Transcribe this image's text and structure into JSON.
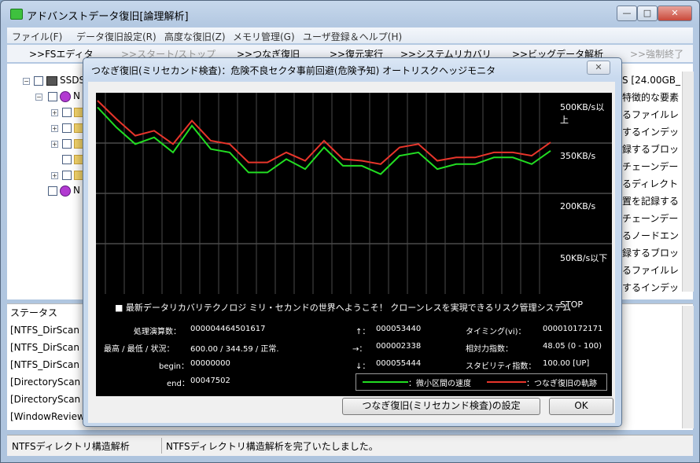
{
  "window": {
    "title": "アドバンストデータ復旧[論理解析]",
    "min_label": "—",
    "max_label": "□",
    "close_label": "✕"
  },
  "menu": [
    "ファイル(F)",
    "データ復旧設定(R)",
    "高度な復旧(Z)",
    "メモリ管理(G)",
    "ユーザ登録＆ヘルプ(H)"
  ],
  "toolbar": [
    {
      "label": ">>FSエディタ",
      "enabled": true
    },
    {
      "label": ">>スタート/ストップ",
      "enabled": false
    },
    {
      "label": ">>つなぎ復旧",
      "enabled": true
    },
    {
      "label": ">>復元実行",
      "enabled": true
    },
    {
      "label": ">>システムリカバリ",
      "enabled": true
    },
    {
      "label": ">>ビッグデータ解析",
      "enabled": true
    },
    {
      "label": ">>強制終了",
      "enabled": false
    }
  ],
  "tree": {
    "root_label": "SSDS",
    "node1_label": "N",
    "node2_label": "N"
  },
  "right_panel": {
    "header": "S [24.00GB_(",
    "rows": [
      "特徴的な要素",
      "るファイルレ",
      "するインデッ",
      "録するブロッ",
      "チェーンデー",
      "るディレクト",
      "置を記録する",
      "チェーンデー",
      "るノードエン",
      "録するブロッ",
      "るファイルレ",
      "するインデッ"
    ]
  },
  "status": {
    "header": "ステータス",
    "rows": [
      "[NTFS_DirScan",
      "[NTFS_DirScan",
      "[NTFS_DirScan",
      "[DirectoryScan",
      "[DirectoryScan",
      "[WindowReview"
    ]
  },
  "statusbar": {
    "left": "NTFSディレクトリ構造解析",
    "right": "NTFSディレクトリ構造解析を完了いたしました。"
  },
  "dialog": {
    "title": "つなぎ復旧(ミリセカンド検査)：危険不良セクタ事前回避(危険予知) オートリスクヘッジモニタ",
    "close_label": "✕",
    "y_labels": [
      "500KB/s以上",
      "350KB/s",
      "200KB/s",
      "50KB/s以下",
      "STOP"
    ],
    "banner": "■ 最新データリカバリテクノロジ ミリ・セカンドの世界へようこそ！ クローンレスを実現できるリスク管理システム",
    "stats": {
      "proc_label": "処理演算数：",
      "proc_value": "000004464501617",
      "max_label": "最高 / 最低 / 状況：",
      "max_value": "600.00 / 344.59 / 正常.",
      "begin_label": "begin：",
      "begin_value": "00000000",
      "end_label": "end：",
      "end_value": "00047502",
      "up_label": "↑：",
      "up_value": "000053440",
      "right_label": "→：",
      "right_value": "000002338",
      "down_label": "↓：",
      "down_value": "000055444",
      "timing_label": "タイミング(vi)：",
      "timing_value": "000010172171",
      "rel_label": "相対力指数：",
      "rel_value": "48.05 (0 - 100)",
      "stab_label": "スタビリティ指数：",
      "stab_value": "100.00 [UP]"
    },
    "legend": {
      "green_label": "：微小区間の速度",
      "red_label": "：つなぎ復旧の軌跡"
    },
    "settings_button": "つなぎ復旧(ミリセカンド検査)の設定",
    "ok_button": "OK",
    "colors": {
      "speed": "#22dd22",
      "trace": "#e8352b",
      "grid": "#707070"
    }
  },
  "chart_data": {
    "type": "line",
    "x": [
      1,
      2,
      3,
      4,
      5,
      6,
      7,
      8,
      9,
      10,
      11,
      12,
      13,
      14,
      15,
      16,
      17,
      18,
      19,
      20,
      21,
      22,
      23,
      24,
      25
    ],
    "series": [
      {
        "name": "微小区間の速度",
        "values": [
          580,
          520,
          470,
          490,
          445,
          525,
          455,
          445,
          385,
          385,
          425,
          395,
          460,
          405,
          405,
          380,
          435,
          445,
          395,
          410,
          410,
          430,
          430,
          410,
          450
        ]
      },
      {
        "name": "つなぎ復旧の軌跡",
        "values": [
          600,
          545,
          495,
          510,
          470,
          540,
          480,
          470,
          415,
          415,
          445,
          420,
          480,
          425,
          420,
          410,
          460,
          470,
          420,
          430,
          430,
          445,
          445,
          435,
          475
        ]
      }
    ],
    "y_axis_labels": [
      "500KB/s以上",
      "350KB/s",
      "200KB/s",
      "50KB/s以下",
      "STOP"
    ],
    "grid": true
  }
}
